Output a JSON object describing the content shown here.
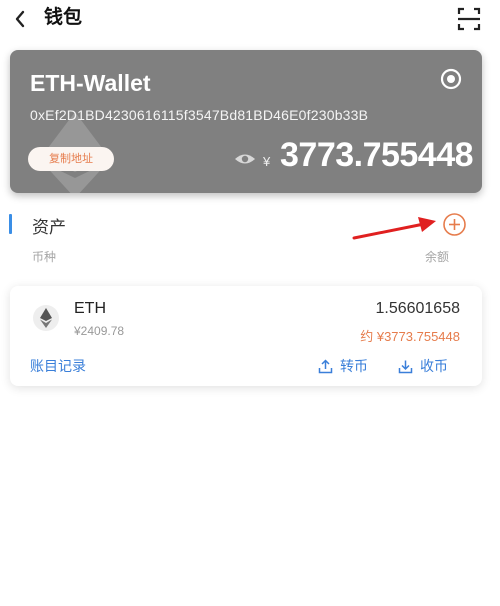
{
  "header": {
    "title": "钱包"
  },
  "wallet": {
    "name": "ETH-Wallet",
    "address": "0xEf2D1BD4230616115f3547Bd81BD46E0f230b33B",
    "copy_label": "复制地址",
    "currency_symbol": "¥",
    "total_value": "3773.755448"
  },
  "assets": {
    "section_title": "资产",
    "col_coin": "币种",
    "col_balance": "余额",
    "items": [
      {
        "symbol": "ETH",
        "price": "¥2409.78",
        "amount": "1.56601658",
        "value": "约 ¥3773.755448",
        "history_label": "账目记录",
        "transfer_label": "转币",
        "receive_label": "收币",
        "icon": "ethereum-icon"
      }
    ]
  },
  "colors": {
    "card_bg": "#808080",
    "accent_orange": "#e67c4c",
    "accent_blue": "#3a7fd9",
    "arrow_red": "#e02020"
  },
  "icons": [
    "back-arrow-icon",
    "scan-icon",
    "eye-icon",
    "plus-circle-icon",
    "ethereum-icon",
    "upload-icon",
    "download-icon"
  ]
}
